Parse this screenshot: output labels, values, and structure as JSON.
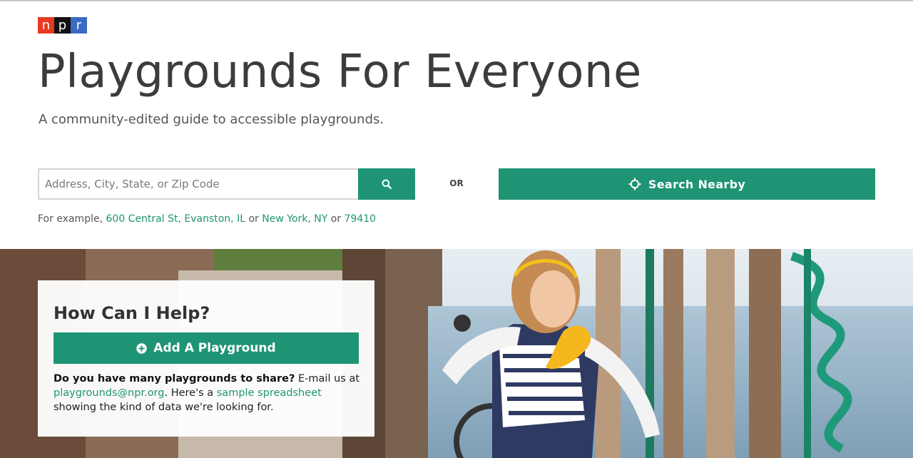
{
  "brand": {
    "letters": [
      "n",
      "p",
      "r"
    ],
    "colors": [
      "#e63a21",
      "#111111",
      "#3a6cc4"
    ]
  },
  "header": {
    "title": "Playgrounds For Everyone",
    "subtitle": "A community-edited guide to accessible playgrounds."
  },
  "search": {
    "placeholder": "Address, City, State, or Zip Code",
    "value": "",
    "search_icon": "search-icon",
    "or_label": "OR",
    "nearby_label": "Search Nearby",
    "nearby_icon": "crosshair-icon"
  },
  "examples": {
    "prefix": "For example,",
    "links": [
      "600 Central St, Evanston, IL",
      "New York, NY",
      "79410"
    ],
    "separator": "or"
  },
  "help": {
    "title": "How Can I Help?",
    "add_label": "Add A Playground",
    "add_icon": "plus-circle-icon",
    "bold_text": "Do you have many playgrounds to share?",
    "text1": " E-mail us at ",
    "email_link": "playgrounds@npr.org",
    "text2": ". Here's a ",
    "spreadsheet_link": "sample spreadsheet",
    "text3": " showing the kind of data we're looking for."
  },
  "colors": {
    "accent": "#1e9474",
    "title": "#3c3c3c"
  }
}
